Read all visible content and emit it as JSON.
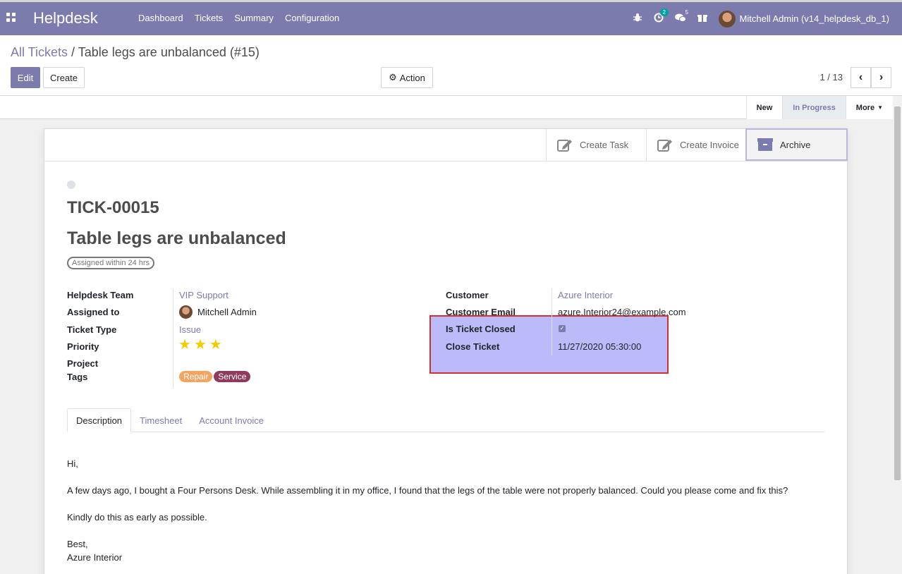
{
  "nav": {
    "brand": "Helpdesk",
    "menu": [
      "Dashboard",
      "Tickets",
      "Summary",
      "Configuration"
    ],
    "activity_count": "2",
    "message_count": "5",
    "user_name": "Mitchell Admin (v14_helpdesk_db_1)"
  },
  "control": {
    "breadcrumb_parent": "All Tickets",
    "breadcrumb_sep": "/",
    "breadcrumb_current": "Table legs are unbalanced (#15)",
    "edit_label": "Edit",
    "create_label": "Create",
    "action_label": "Action",
    "pager": "1 / 13"
  },
  "stages": {
    "new": "New",
    "in_progress": "In Progress",
    "more": "More"
  },
  "smart_buttons": {
    "create_task": "Create Task",
    "create_invoice": "Create Invoice",
    "archive": "Archive"
  },
  "ticket": {
    "ref": "TICK-00015",
    "name": "Table legs are unbalanced",
    "sla": "Assigned within 24 hrs"
  },
  "left_fields": {
    "team_label": "Helpdesk Team",
    "team_value": "VIP Support",
    "assigned_label": "Assigned to",
    "assigned_value": "Mitchell Admin",
    "type_label": "Ticket Type",
    "type_value": "Issue",
    "priority_label": "Priority",
    "priority_stars": 3,
    "project_label": "Project",
    "tags_label": "Tags",
    "tags": [
      {
        "name": "Repair",
        "color": "#f4a460"
      },
      {
        "name": "Service",
        "color": "#8e3b5e"
      }
    ]
  },
  "right_fields": {
    "customer_label": "Customer",
    "customer_value": "Azure Interior",
    "email_label": "Customer Email",
    "email_value": "azure.Interior24@example.com",
    "closed_label": "Is Ticket Closed",
    "closed_value": true,
    "close_label": "Close Ticket",
    "close_value": "11/27/2020 05:30:00"
  },
  "tabs": [
    "Description",
    "Timesheet",
    "Account Invoice"
  ],
  "description": {
    "greeting": "Hi,",
    "body": "A few days ago, I bought a Four Persons Desk. While assembling it in my office, I found that the legs of the table were not properly balanced. Could you please come and fix this?",
    "request": "Kindly do this as early as possible.",
    "closing": "Best,",
    "signature": "Azure Interior"
  },
  "colors": {
    "brand": "#7c7bad",
    "highlight_border": "#d32f2f",
    "star": "#f3cc00"
  }
}
